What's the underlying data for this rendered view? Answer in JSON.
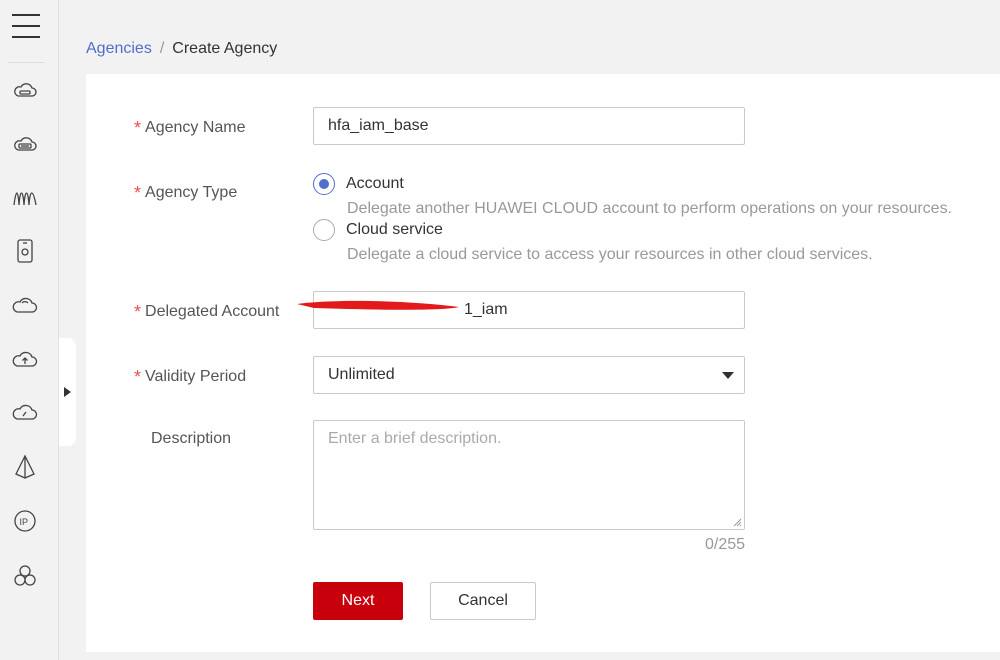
{
  "breadcrumb": {
    "parent": "Agencies",
    "separator": "/",
    "current": "Create Agency"
  },
  "sidebar": {
    "icons": [
      "cloud-server-icon",
      "cloud-storage-icon",
      "network-waves-icon",
      "phone-device-icon",
      "cloud-outline-icon",
      "cloud-upload-icon",
      "cloud-gauge-icon",
      "pyramid-icon",
      "ip-icon",
      "cluster-icon"
    ]
  },
  "form": {
    "required_mark": "*",
    "agency_name": {
      "label": "Agency Name",
      "value": "hfa_iam_base"
    },
    "agency_type": {
      "label": "Agency Type",
      "options": [
        {
          "label": "Account",
          "description": "Delegate another HUAWEI CLOUD account to perform operations on your resources.",
          "checked": true
        },
        {
          "label": "Cloud service",
          "description": "Delegate a cloud service to access your resources in other cloud services.",
          "checked": false
        }
      ]
    },
    "delegated_account": {
      "label": "Delegated Account",
      "value": "1_iam"
    },
    "validity_period": {
      "label": "Validity Period",
      "value": "Unlimited"
    },
    "description": {
      "label": "Description",
      "placeholder": "Enter a brief description.",
      "counter": "0/255"
    }
  },
  "actions": {
    "next": "Next",
    "cancel": "Cancel"
  },
  "colors": {
    "accent": "#526ecc",
    "primary_button": "#c7000b",
    "required": "#e8504f"
  }
}
